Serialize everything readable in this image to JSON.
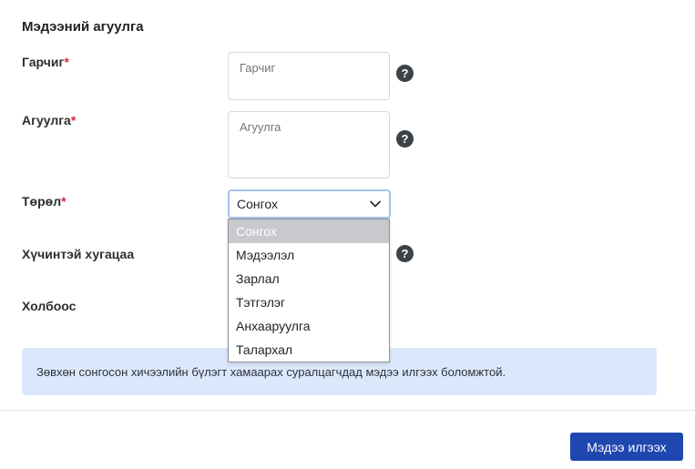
{
  "section": {
    "title": "Мэдээний агуулга"
  },
  "required_mark": "*",
  "fields": {
    "title": {
      "label": "Гарчиг",
      "placeholder": "Гарчиг",
      "value": ""
    },
    "content": {
      "label": "Агуулга",
      "placeholder": "Агуулга",
      "value": ""
    },
    "type": {
      "label": "Төрөл",
      "selected": "Сонгох"
    },
    "validity": {
      "label": "Хүчинтэй хугацаа"
    },
    "link": {
      "label": "Холбоос"
    }
  },
  "help_glyph": "?",
  "dropdown": {
    "options": [
      "Сонгох",
      "Мэдээлэл",
      "Зарлал",
      "Тэтгэлэг",
      "Анхааруулга",
      "Талархал"
    ]
  },
  "info": {
    "text": "Зөвхөн сонгосон хичээлийн бүлэгт хамаарах суралцагчдад мэдээ илгээх боломжтой."
  },
  "actions": {
    "submit_label": "Мэдээ илгээх"
  },
  "colors": {
    "primary": "#1f47b0",
    "required": "#d9263a",
    "info_bg": "#dbe8fb",
    "option_selected_bg": "#c7c9cc"
  },
  "icons": {
    "help": "question-circle-icon",
    "chevron": "chevron-down-icon"
  }
}
